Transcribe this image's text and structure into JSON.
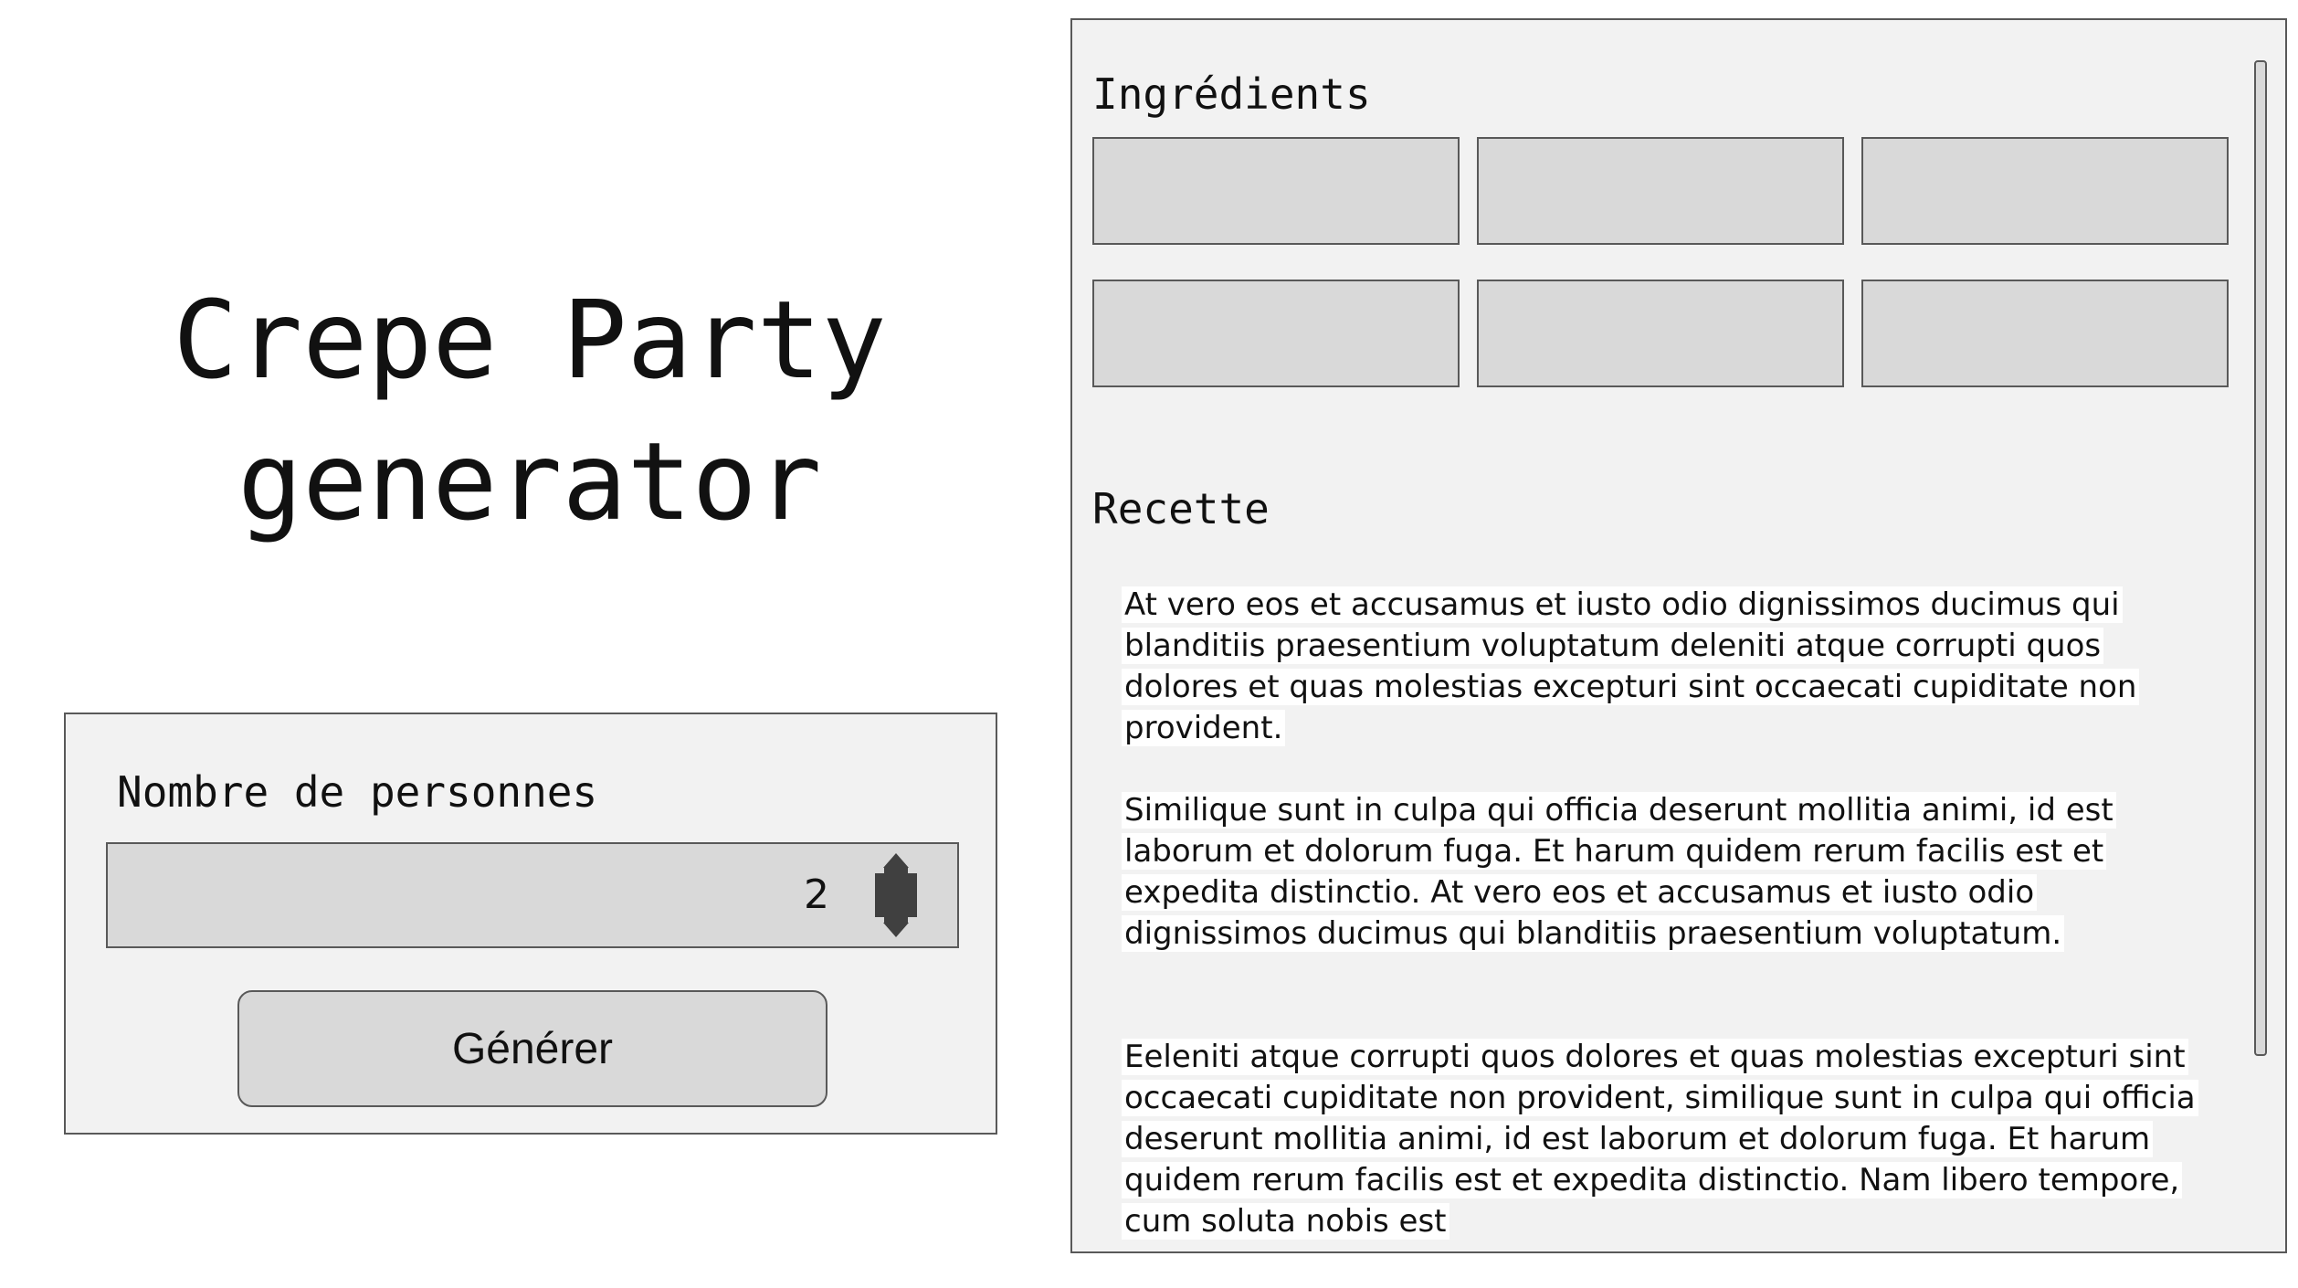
{
  "title": {
    "line1": "Crepe Party",
    "line2": "generator"
  },
  "form": {
    "people_label": "Nombre de personnes",
    "people_value": "2",
    "generate_label": "Générer"
  },
  "ingredients": {
    "heading": "Ingrédients",
    "cells": [
      "",
      "",
      "",
      "",
      "",
      ""
    ]
  },
  "recipe": {
    "heading": "Recette",
    "paragraphs": [
      "At vero eos et accusamus et iusto odio dignissimos ducimus qui blanditiis praesentium voluptatum deleniti atque corrupti quos dolores et quas molestias excepturi sint occaecati cupiditate non provident.",
      "Similique sunt in culpa qui officia deserunt mollitia animi, id est laborum et dolorum fuga. Et harum quidem rerum facilis est et expedita distinctio. At vero eos et accusamus et iusto odio dignissimos ducimus qui blanditiis praesentium voluptatum.",
      "Eeleniti atque corrupti quos dolores et quas molestias excepturi sint occaecati cupiditate non provident, similique sunt in culpa qui officia deserunt mollitia animi, id est laborum et dolorum fuga. Et harum quidem rerum facilis est et expedita distinctio. Nam libero tempore, cum soluta nobis est"
    ]
  },
  "icons": {
    "spinner": "up-down-spinner-icon"
  },
  "colors": {
    "panel_bg": "#f2f2f2",
    "field_bg": "#d9d9d9",
    "border": "#595959"
  }
}
